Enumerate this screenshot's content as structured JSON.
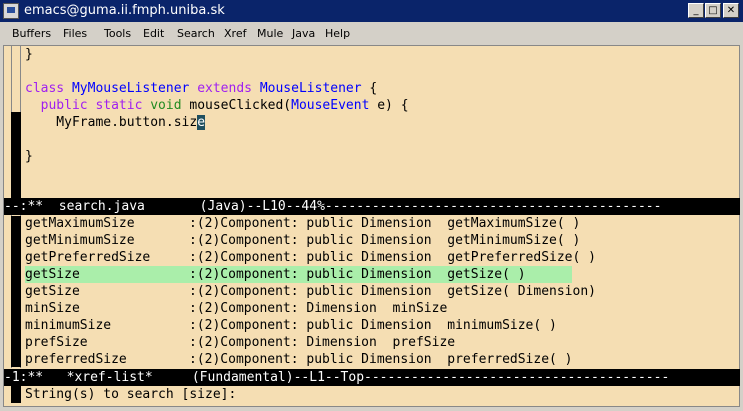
{
  "window": {
    "title": "emacs@guma.ii.fmph.uniba.sk",
    "buttons": {
      "minimize": "_",
      "maximize": "□",
      "close": "✕"
    }
  },
  "menu": [
    "Buffers",
    "Files",
    "Tools",
    "Edit",
    "Search",
    "Xref",
    "Mule",
    "Java",
    "Help"
  ],
  "code": {
    "line0": "}",
    "line2": {
      "kw1": "class",
      "name": "MyMouseListener",
      "kw2": "extends",
      "parent": "MouseListener",
      "rest": " {"
    },
    "line3": {
      "indent": "  ",
      "kw": "public static",
      "ty": "void",
      "mid": " mouseClicked(",
      "param": "MouseEvent",
      "rest": " e) {"
    },
    "line4": {
      "text": "    MyFrame.button.siz",
      "cursor_char": "e"
    },
    "line6": "}"
  },
  "modeline_top": "--:**  search.java       (Java)--L10--44%-------------------------------------------",
  "xref_rows": [
    {
      "name": "getMaximumSize",
      "info": ":(2)Component: public Dimension  getMaximumSize( )",
      "selected": false
    },
    {
      "name": "getMinimumSize",
      "info": ":(2)Component: public Dimension  getMinimumSize( )",
      "selected": false
    },
    {
      "name": "getPreferredSize",
      "info": ":(2)Component: public Dimension  getPreferredSize( )",
      "selected": false
    },
    {
      "name": "getSize",
      "info": ":(2)Component: public Dimension  getSize( )",
      "selected": true
    },
    {
      "name": "getSize",
      "info": ":(2)Component: public Dimension  getSize( Dimension)",
      "selected": false
    },
    {
      "name": "minSize",
      "info": ":(2)Component: Dimension  minSize",
      "selected": false
    },
    {
      "name": "minimumSize",
      "info": ":(2)Component: public Dimension  minimumSize( )",
      "selected": false
    },
    {
      "name": "prefSize",
      "info": ":(2)Component: Dimension  prefSize",
      "selected": false
    },
    {
      "name": "preferredSize",
      "info": ":(2)Component: public Dimension  preferredSize( )",
      "selected": false
    }
  ],
  "modeline_bottom": "-1:**   *xref-list*     (Fundamental)--L1--Top---------------------------------------",
  "minibuffer": "String(s) to search [size]:"
}
